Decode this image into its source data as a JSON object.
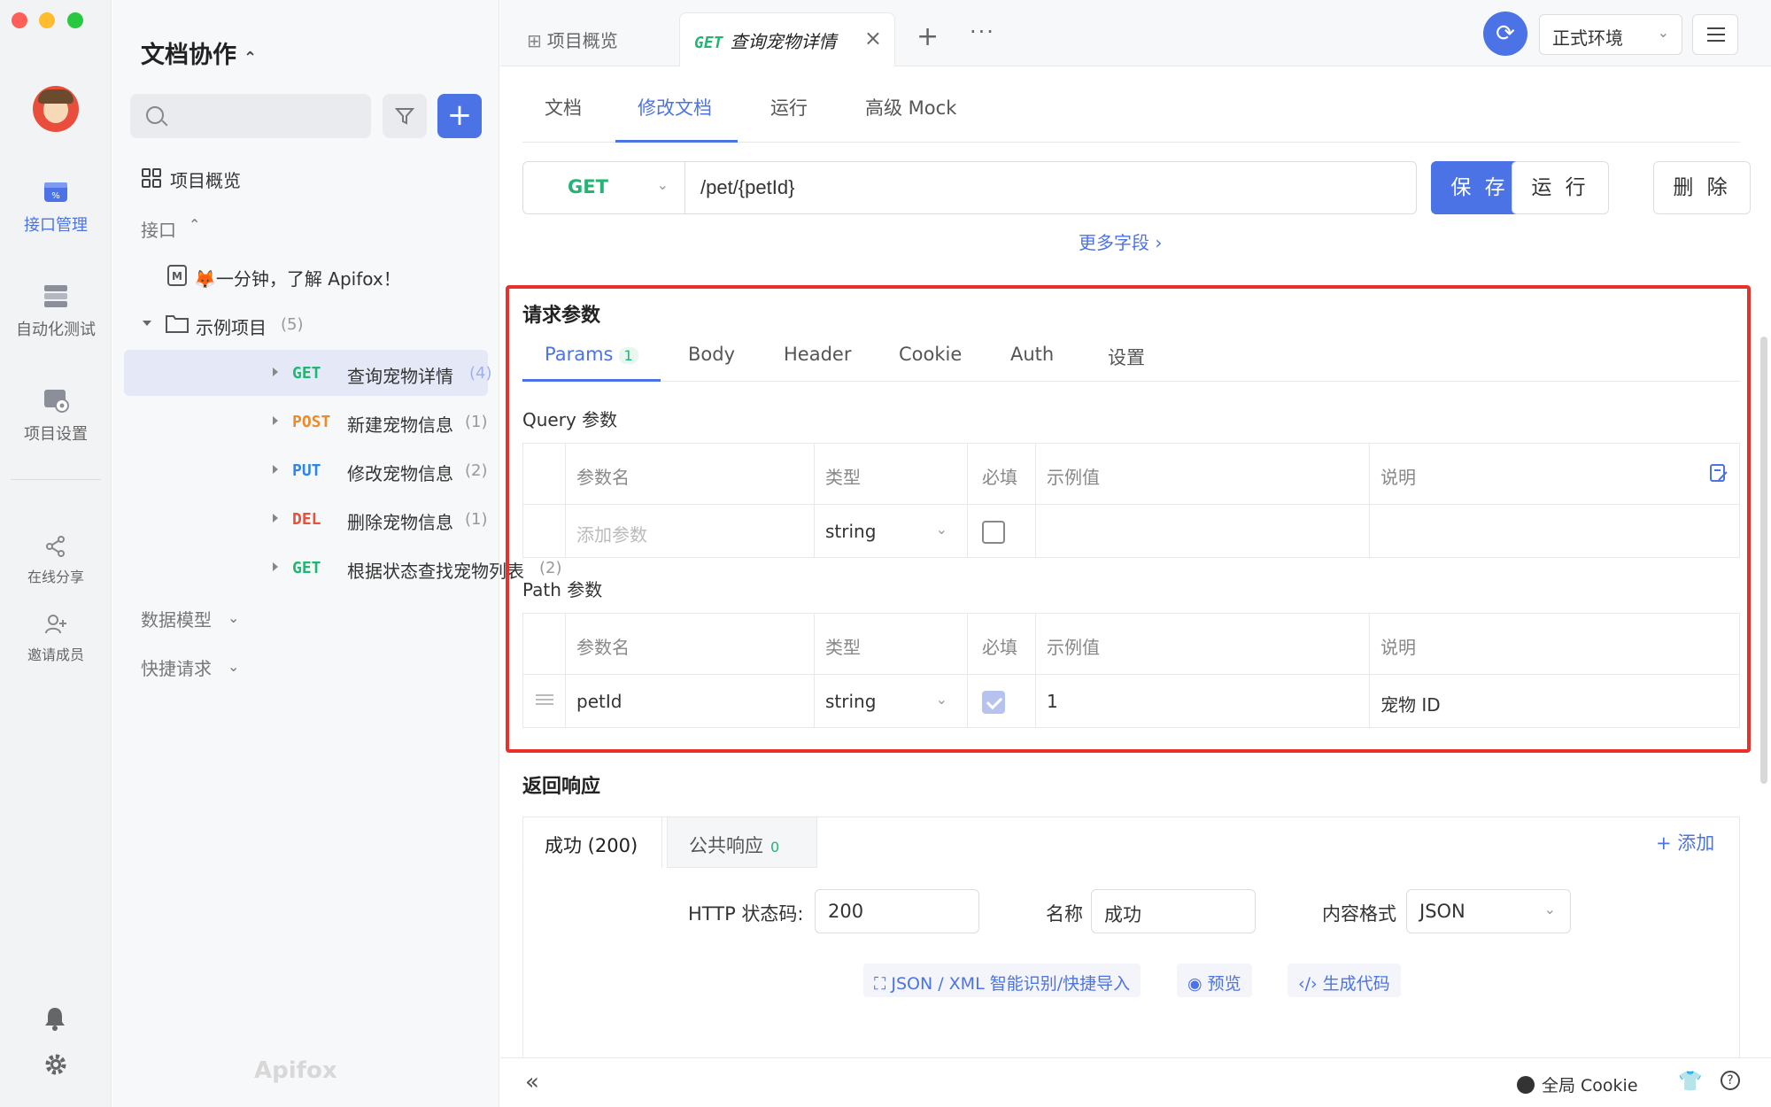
{
  "rail": {
    "items": [
      {
        "label": "接口管理",
        "icon": "api-management-icon"
      },
      {
        "label": "自动化测试",
        "icon": "automation-test-icon"
      },
      {
        "label": "项目设置",
        "icon": "project-settings-icon"
      },
      {
        "label": "在线分享",
        "icon": "share-icon"
      },
      {
        "label": "邀请成员",
        "icon": "invite-member-icon"
      }
    ],
    "accent": "#4c73e6"
  },
  "sidebar": {
    "project_title": "文档协作",
    "search_placeholder": "",
    "overview": "项目概览",
    "interface_group": "接口",
    "intro_doc": "🦊一分钟，了解 Apifox！",
    "folder": {
      "name": "示例项目",
      "count": "(5)"
    },
    "endpoints": [
      {
        "method": "GET",
        "name": "查询宠物详情",
        "count": "(4)"
      },
      {
        "method": "POST",
        "name": "新建宠物信息",
        "count": "(1)"
      },
      {
        "method": "PUT",
        "name": "修改宠物信息",
        "count": "(2)"
      },
      {
        "method": "DEL",
        "name": "删除宠物信息",
        "count": "(1)"
      },
      {
        "method": "GET",
        "name": "根据状态查找宠物列表",
        "count": "(2)"
      }
    ],
    "data_models": "数据模型",
    "quick_requests": "快捷请求",
    "brand": "Apifox"
  },
  "topbar": {
    "tabs": [
      {
        "label": "项目概览"
      },
      {
        "method": "GET",
        "label": "查询宠物详情"
      }
    ],
    "plus": "+",
    "more": "···",
    "env": "正式环境"
  },
  "doc_tabs": [
    "文档",
    "修改文档",
    "运行",
    "高级 Mock"
  ],
  "request": {
    "method": "GET",
    "path": "/pet/{petId}",
    "save": "保 存",
    "run": "运 行",
    "delete": "删 除",
    "more_fields": "更多字段 ›"
  },
  "params": {
    "title": "请求参数",
    "tabs": [
      {
        "label": "Params",
        "badge": "1"
      },
      {
        "label": "Body"
      },
      {
        "label": "Header"
      },
      {
        "label": "Cookie"
      },
      {
        "label": "Auth"
      },
      {
        "label": "设置"
      }
    ],
    "columns": [
      "参数名",
      "类型",
      "必填",
      "示例值",
      "说明"
    ],
    "query_label": "Query 参数",
    "query_row": {
      "placeholder": "添加参数",
      "type": "string",
      "required": false
    },
    "path_label": "Path 参数",
    "path_row": {
      "name": "petId",
      "type": "string",
      "required": true,
      "example": "1",
      "desc": "宠物 ID"
    }
  },
  "response": {
    "title": "返回响应",
    "tabs": [
      {
        "label": "成功 (200)"
      },
      {
        "label": "公共响应",
        "badge": "0"
      }
    ],
    "add": "+ 添加",
    "status_label": "HTTP 状态码:",
    "status": "200",
    "name_label": "名称",
    "name": "成功",
    "format_label": "内容格式",
    "format": "JSON",
    "actions": [
      "JSON / XML 智能识别/快捷导入",
      "预览",
      "生成代码"
    ]
  },
  "bottombar": {
    "collapse": "«",
    "cookie": "全局 Cookie"
  }
}
